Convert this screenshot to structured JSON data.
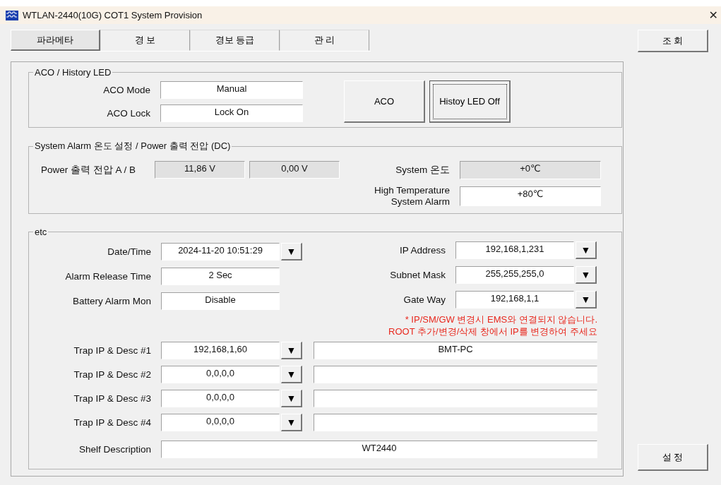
{
  "window": {
    "title": "WTLAN-2440(10G) COT1 System Provision",
    "close": "✕"
  },
  "tabs": [
    {
      "label": "파라메타",
      "selected": true
    },
    {
      "label": "경 보",
      "selected": false
    },
    {
      "label": "경보 등급",
      "selected": false
    },
    {
      "label": "관 리",
      "selected": false
    }
  ],
  "query_button": "조 회",
  "aco_group": {
    "title": "ACO / History LED",
    "fields": [
      {
        "label": "ACO Mode",
        "value": "Manual"
      },
      {
        "label": "ACO Lock",
        "value": "Lock On"
      }
    ],
    "buttons": [
      {
        "label": "ACO",
        "focused": false
      },
      {
        "label": "Histoy LED Off",
        "focused": true
      }
    ]
  },
  "system_group": {
    "title": "System Alarm 온도 설정 / Power 출력 전압 (DC)",
    "power_label": "Power 출력 전압 A / B",
    "power_values": [
      "11,86 V",
      "0,00 V"
    ],
    "temps": [
      {
        "label": "System 온도",
        "value": "+0℃",
        "readonly": true
      },
      {
        "label": "High Temperature\nSystem Alarm",
        "value": "+80℃",
        "readonly": false
      }
    ]
  },
  "etc_group": {
    "title": "etc",
    "left_fields": [
      {
        "label": "Date/Time",
        "value": "2024-11-20 10:51:29",
        "arrow": "▼"
      },
      {
        "label": "Alarm Release Time",
        "value": "2 Sec"
      },
      {
        "label": "Battery Alarm Mon",
        "value": "Disable"
      }
    ],
    "right_fields": [
      {
        "label": "IP Address",
        "value": "192,168,1,231",
        "arrow": "▼"
      },
      {
        "label": "Subnet Mask",
        "value": "255,255,255,0",
        "arrow": "▼"
      },
      {
        "label": "Gate Way",
        "value": "192,168,1,1",
        "arrow": "▼"
      }
    ],
    "notes": [
      "* IP/SM/GW 변경시 EMS와 연결되지 않습니다.",
      "ROOT 추가/변경/삭제 창에서 IP를 변경하여 주세요"
    ],
    "traps": [
      {
        "label": "Trap IP & Desc #1",
        "ip": "192,168,1,60",
        "arrow": "▼",
        "desc": "BMT-PC"
      },
      {
        "label": "Trap IP & Desc #2",
        "ip": "0,0,0,0",
        "arrow": "▼"
      },
      {
        "label": "Trap IP & Desc #3",
        "ip": "0,0,0,0",
        "arrow": "▼"
      },
      {
        "label": "Trap IP & Desc #4",
        "ip": "0,0,0,0",
        "arrow": "▼"
      }
    ],
    "shelf": {
      "label": "Shelf Description",
      "value": "WT2440"
    }
  },
  "set_button": "설 정"
}
